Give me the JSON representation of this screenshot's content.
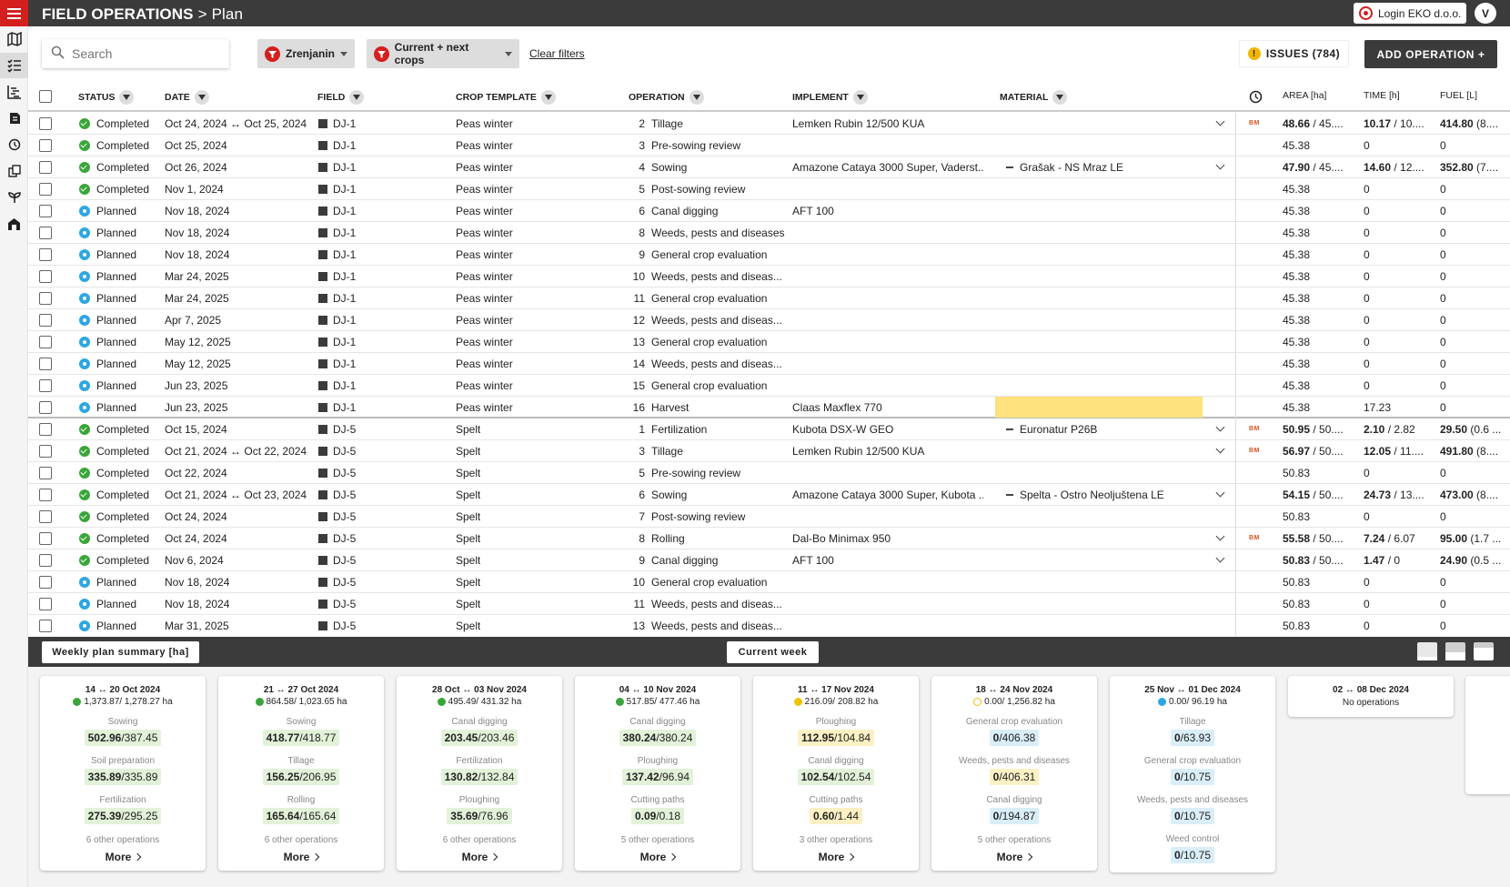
{
  "header": {
    "app": "FIELD OPERATIONS",
    "separator": ">",
    "page": "Plan",
    "login": "Login EKO d.o.o.",
    "avatar": "V"
  },
  "toolbar": {
    "search_placeholder": "Search",
    "filter_location": "Zrenjanin",
    "filter_crops": "Current + next crops",
    "clear_filters": "Clear filters",
    "issues": "ISSUES (784)",
    "add_operation": "ADD OPERATION +"
  },
  "columns": {
    "status": "STATUS",
    "date": "DATE",
    "field": "FIELD",
    "crop": "CROP TEMPLATE",
    "operation": "OPERATION",
    "implement": "IMPLEMENT",
    "material": "MATERIAL",
    "area": "AREA [ha]",
    "time": "TIME [h]",
    "fuel": "FUEL [L]"
  },
  "rows": [
    {
      "status": "Completed",
      "date": "Oct 24, 2024 ↔ Oct 25, 2024",
      "field": "DJ-1",
      "crop": "Peas winter",
      "opnum": "2",
      "op": "Tillage",
      "implement": "Lemken Rubin 12/500 KUA",
      "material": "",
      "bm": "BM",
      "area": "48.66",
      "area2": " / 45....",
      "time": "10.17",
      "time2": " / 10....",
      "fuel": "414.80",
      "fuel2": " (8....",
      "chev": true
    },
    {
      "status": "Completed",
      "date": "Oct 25, 2024",
      "field": "DJ-1",
      "crop": "Peas winter",
      "opnum": "3",
      "op": "Pre-sowing review",
      "implement": "",
      "material": "",
      "area2": "45.38",
      "time2": "0",
      "fuel2": "0"
    },
    {
      "status": "Completed",
      "date": "Oct 26, 2024",
      "field": "DJ-1",
      "crop": "Peas winter",
      "opnum": "4",
      "op": "Sowing",
      "implement": "Amazone Cataya 3000 Super, Vaderst...",
      "material": "Grašak - NS Mraz LE",
      "area": "47.90",
      "area2": " / 45....",
      "time": "14.60",
      "time2": " / 12....",
      "fuel": "352.80",
      "fuel2": " (7....",
      "chev": true
    },
    {
      "status": "Completed",
      "date": "Nov 1, 2024",
      "field": "DJ-1",
      "crop": "Peas winter",
      "opnum": "5",
      "op": "Post-sowing review",
      "implement": "",
      "material": "",
      "area2": "45.38",
      "time2": "0",
      "fuel2": "0"
    },
    {
      "status": "Planned",
      "date": "Nov 18, 2024",
      "field": "DJ-1",
      "crop": "Peas winter",
      "opnum": "6",
      "op": "Canal digging",
      "implement": "AFT 100",
      "material": "",
      "area2": "45.38",
      "time2": "0",
      "fuel2": "0"
    },
    {
      "status": "Planned",
      "date": "Nov 18, 2024",
      "field": "DJ-1",
      "crop": "Peas winter",
      "opnum": "8",
      "op": "Weeds, pests and diseases",
      "implement": "",
      "material": "",
      "area2": "45.38",
      "time2": "0",
      "fuel2": "0"
    },
    {
      "status": "Planned",
      "date": "Nov 18, 2024",
      "field": "DJ-1",
      "crop": "Peas winter",
      "opnum": "9",
      "op": "General crop evaluation",
      "implement": "",
      "material": "",
      "area2": "45.38",
      "time2": "0",
      "fuel2": "0"
    },
    {
      "status": "Planned",
      "date": "Mar 24, 2025",
      "field": "DJ-1",
      "crop": "Peas winter",
      "opnum": "10",
      "op": "Weeds, pests and diseas...",
      "implement": "",
      "material": "",
      "area2": "45.38",
      "time2": "0",
      "fuel2": "0"
    },
    {
      "status": "Planned",
      "date": "Mar 24, 2025",
      "field": "DJ-1",
      "crop": "Peas winter",
      "opnum": "11",
      "op": "General crop evaluation",
      "implement": "",
      "material": "",
      "area2": "45.38",
      "time2": "0",
      "fuel2": "0"
    },
    {
      "status": "Planned",
      "date": "Apr 7, 2025",
      "field": "DJ-1",
      "crop": "Peas winter",
      "opnum": "12",
      "op": "Weeds, pests and diseas...",
      "implement": "",
      "material": "",
      "area2": "45.38",
      "time2": "0",
      "fuel2": "0"
    },
    {
      "status": "Planned",
      "date": "May 12, 2025",
      "field": "DJ-1",
      "crop": "Peas winter",
      "opnum": "13",
      "op": "General crop evaluation",
      "implement": "",
      "material": "",
      "area2": "45.38",
      "time2": "0",
      "fuel2": "0"
    },
    {
      "status": "Planned",
      "date": "May 12, 2025",
      "field": "DJ-1",
      "crop": "Peas winter",
      "opnum": "14",
      "op": "Weeds, pests and diseas...",
      "implement": "",
      "material": "",
      "area2": "45.38",
      "time2": "0",
      "fuel2": "0"
    },
    {
      "status": "Planned",
      "date": "Jun 23, 2025",
      "field": "DJ-1",
      "crop": "Peas winter",
      "opnum": "15",
      "op": "General crop evaluation",
      "implement": "",
      "material": "",
      "area2": "45.38",
      "time2": "0",
      "fuel2": "0"
    },
    {
      "status": "Planned",
      "date": "Jun 23, 2025",
      "field": "DJ-1",
      "crop": "Peas winter",
      "opnum": "16",
      "op": "Harvest",
      "implement": "Claas Maxflex 770",
      "material": "",
      "warn": true,
      "area2": "45.38",
      "time2": "17.23",
      "fuel2": "0",
      "sep": true
    },
    {
      "status": "Completed",
      "date": "Oct 15, 2024",
      "field": "DJ-5",
      "crop": "Spelt",
      "opnum": "1",
      "op": "Fertilization",
      "implement": "Kubota DSX-W GEO",
      "material": "Euronatur P26B",
      "bm": "BM",
      "area": "50.95",
      "area2": " / 50....",
      "time": "2.10",
      "time2": " / 2.82",
      "fuel": "29.50",
      "fuel2": " (0.6 ...",
      "chev": true
    },
    {
      "status": "Completed",
      "date": "Oct 21, 2024 ↔ Oct 22, 2024",
      "field": "DJ-5",
      "crop": "Spelt",
      "opnum": "3",
      "op": "Tillage",
      "implement": "Lemken Rubin 12/500 KUA",
      "material": "",
      "bm": "BM",
      "area": "56.97",
      "area2": " / 50....",
      "time": "12.05",
      "time2": " / 11....",
      "fuel": "491.80",
      "fuel2": " (8....",
      "chev": true
    },
    {
      "status": "Completed",
      "date": "Oct 22, 2024",
      "field": "DJ-5",
      "crop": "Spelt",
      "opnum": "5",
      "op": "Pre-sowing review",
      "implement": "",
      "material": "",
      "area2": "50.83",
      "time2": "0",
      "fuel2": "0"
    },
    {
      "status": "Completed",
      "date": "Oct 21, 2024 ↔ Oct 23, 2024",
      "field": "DJ-5",
      "crop": "Spelt",
      "opnum": "6",
      "op": "Sowing",
      "implement": "Amazone Cataya 3000 Super, Kubota ...",
      "material": "Spelta - Ostro Neoljuštena LE",
      "area": "54.15",
      "area2": " / 50....",
      "time": "24.73",
      "time2": " / 13....",
      "fuel": "473.00",
      "fuel2": " (8....",
      "chev": true
    },
    {
      "status": "Completed",
      "date": "Oct 24, 2024",
      "field": "DJ-5",
      "crop": "Spelt",
      "opnum": "7",
      "op": "Post-sowing review",
      "implement": "",
      "material": "",
      "area2": "50.83",
      "time2": "0",
      "fuel2": "0"
    },
    {
      "status": "Completed",
      "date": "Oct 24, 2024",
      "field": "DJ-5",
      "crop": "Spelt",
      "opnum": "8",
      "op": "Rolling",
      "implement": "Dal-Bo Minimax 950",
      "material": "",
      "bm": "BM",
      "area": "55.58",
      "area2": " / 50....",
      "time": "7.24",
      "time2": " / 6.07",
      "fuel": "95.00",
      "fuel2": " (1.7 ...",
      "chev": true
    },
    {
      "status": "Completed",
      "date": "Nov 6, 2024",
      "field": "DJ-5",
      "crop": "Spelt",
      "opnum": "9",
      "op": "Canal digging",
      "implement": "AFT 100",
      "material": "",
      "area": "50.83",
      "area2": " / 50....",
      "time": "1.47",
      "time2": " / 0",
      "fuel": "24.90",
      "fuel2": " (0.5 ...",
      "chev": true
    },
    {
      "status": "Planned",
      "date": "Nov 18, 2024",
      "field": "DJ-5",
      "crop": "Spelt",
      "opnum": "10",
      "op": "General crop evaluation",
      "implement": "",
      "material": "",
      "area2": "50.83",
      "time2": "0",
      "fuel2": "0"
    },
    {
      "status": "Planned",
      "date": "Nov 18, 2024",
      "field": "DJ-5",
      "crop": "Spelt",
      "opnum": "11",
      "op": "Weeds, pests and diseas...",
      "implement": "",
      "material": "",
      "area2": "50.83",
      "time2": "0",
      "fuel2": "0"
    },
    {
      "status": "Planned",
      "date": "Mar 31, 2025",
      "field": "DJ-5",
      "crop": "Spelt",
      "opnum": "13",
      "op": "Weeds, pests and diseas...",
      "implement": "",
      "material": "",
      "area2": "50.83",
      "time2": "0",
      "fuel2": "0"
    }
  ],
  "summary": {
    "weekly_btn": "Weekly plan summary [ha]",
    "current_week": "Current week"
  },
  "weeks": [
    {
      "title": "14 ↔ 20 Oct 2024",
      "dot": "g",
      "total": "1,373.87/ 1,278.27 ha",
      "ops": [
        {
          "label": "Sowing",
          "a": "502.96",
          "b": "/387.45",
          "c": "g"
        },
        {
          "label": "Soil preparation",
          "a": "335.89",
          "b": "/335.89",
          "c": "g"
        },
        {
          "label": "Fertilization",
          "a": "275.39",
          "b": "/295.25",
          "c": "g"
        }
      ],
      "other": "6 other operations",
      "more": "More"
    },
    {
      "title": "21 ↔ 27 Oct 2024",
      "dot": "g",
      "total": "864.58/ 1,023.65 ha",
      "ops": [
        {
          "label": "Sowing",
          "a": "418.77",
          "b": "/418.77",
          "c": "g"
        },
        {
          "label": "Tillage",
          "a": "156.25",
          "b": "/206.95",
          "c": "g"
        },
        {
          "label": "Rolling",
          "a": "165.64",
          "b": "/165.64",
          "c": "g"
        }
      ],
      "other": "6 other operations",
      "more": "More"
    },
    {
      "title": "28 Oct ↔ 03 Nov 2024",
      "dot": "g",
      "total": "495.49/ 431.32 ha",
      "ops": [
        {
          "label": "Canal digging",
          "a": "203.45",
          "b": "/203.46",
          "c": "g"
        },
        {
          "label": "Fertilization",
          "a": "130.82",
          "b": "/132.84",
          "c": "g"
        },
        {
          "label": "Ploughing",
          "a": "35.69",
          "b": "/76.96",
          "c": "g"
        }
      ],
      "other": "6 other operations",
      "more": "More"
    },
    {
      "title": "04 ↔ 10 Nov 2024",
      "dot": "g",
      "total": "517.85/ 477.46 ha",
      "ops": [
        {
          "label": "Canal digging",
          "a": "380.24",
          "b": "/380.24",
          "c": "g"
        },
        {
          "label": "Ploughing",
          "a": "137.42",
          "b": "/96.94",
          "c": "g"
        },
        {
          "label": "Cutting paths",
          "a": "0.09",
          "b": "/0.18",
          "c": "g"
        }
      ],
      "other": "5 other operations",
      "more": "More"
    },
    {
      "title": "11 ↔ 17 Nov 2024",
      "dot": "y",
      "total": "216.09/ 208.82 ha",
      "ops": [
        {
          "label": "Ploughing",
          "a": "112.95",
          "b": "/104.84",
          "c": "y"
        },
        {
          "label": "Canal digging",
          "a": "102.54",
          "b": "/102.54",
          "c": "g"
        },
        {
          "label": "Cutting paths",
          "a": "0.60",
          "b": "/1.44",
          "c": "y"
        }
      ],
      "other": "3 other operations",
      "more": "More"
    },
    {
      "title": "18 ↔ 24 Nov 2024",
      "dot": "yo",
      "total": "0.00/ 1,256.82 ha",
      "ops": [
        {
          "label": "General crop evaluation",
          "a": "0",
          "b": "/406.38",
          "c": "b"
        },
        {
          "label": "Weeds, pests and diseases",
          "a": "0",
          "b": "/406.31",
          "c": "y"
        },
        {
          "label": "Canal digging",
          "a": "0",
          "b": "/194.87",
          "c": "b"
        }
      ],
      "other": "5 other operations",
      "more": "More"
    },
    {
      "title": "25 Nov ↔ 01 Dec 2024",
      "dot": "b",
      "total": "0.00/ 96.19 ha",
      "ops": [
        {
          "label": "Tillage",
          "a": "0",
          "b": "/63.93",
          "c": "b"
        },
        {
          "label": "General crop evaluation",
          "a": "0",
          "b": "/10.75",
          "c": "b"
        },
        {
          "label": "Weeds, pests and diseases",
          "a": "0",
          "b": "/10.75",
          "c": "b"
        },
        {
          "label": "Weed control",
          "a": "0",
          "b": "/10.75",
          "c": "b"
        }
      ],
      "other": "",
      "more": ""
    },
    {
      "title": "02 ↔ 08 Dec 2024",
      "dot": "",
      "total": "",
      "noops": "No operations",
      "ops": [],
      "other": "",
      "more": ""
    }
  ],
  "colors": {
    "accent_red": "#d41f1f",
    "dark": "#3b3b3b",
    "completed": "#3aa53a",
    "planned": "#2ea7e0",
    "warning_bg": "#fde27d"
  },
  "icons": [
    "menu-icon",
    "map-icon",
    "list-icon",
    "gantt-icon",
    "layers-icon",
    "clock-icon",
    "copy-icon",
    "sprout-icon",
    "barn-icon",
    "search-icon",
    "filter-icon",
    "warning-icon",
    "info-icon"
  ]
}
